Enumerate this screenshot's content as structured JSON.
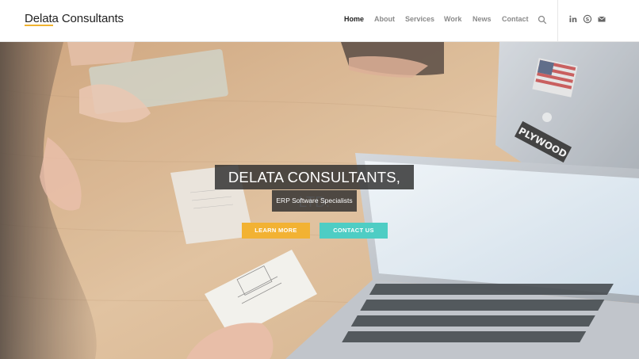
{
  "brand": {
    "name": "Delata Consultants",
    "accent": "#f0b330"
  },
  "nav": {
    "items": [
      {
        "label": "Home",
        "active": true
      },
      {
        "label": "About",
        "active": false
      },
      {
        "label": "Services",
        "active": false
      },
      {
        "label": "Work",
        "active": false
      },
      {
        "label": "News",
        "active": false
      },
      {
        "label": "Contact",
        "active": false
      }
    ],
    "search_icon": "search-icon"
  },
  "social": [
    "linkedin-icon",
    "skype-icon",
    "mail-icon"
  ],
  "hero": {
    "title": "DELATA CONSULTANTS, LTD.",
    "subtitle": "ERP Software Specialists",
    "buttons": {
      "learn_more": "LEARN MORE",
      "contact_us": "CONTACT US"
    },
    "colors": {
      "learn_more": "#f2b233",
      "contact_us": "#4ecdc4",
      "label_bg": "#2d2d2d"
    }
  }
}
